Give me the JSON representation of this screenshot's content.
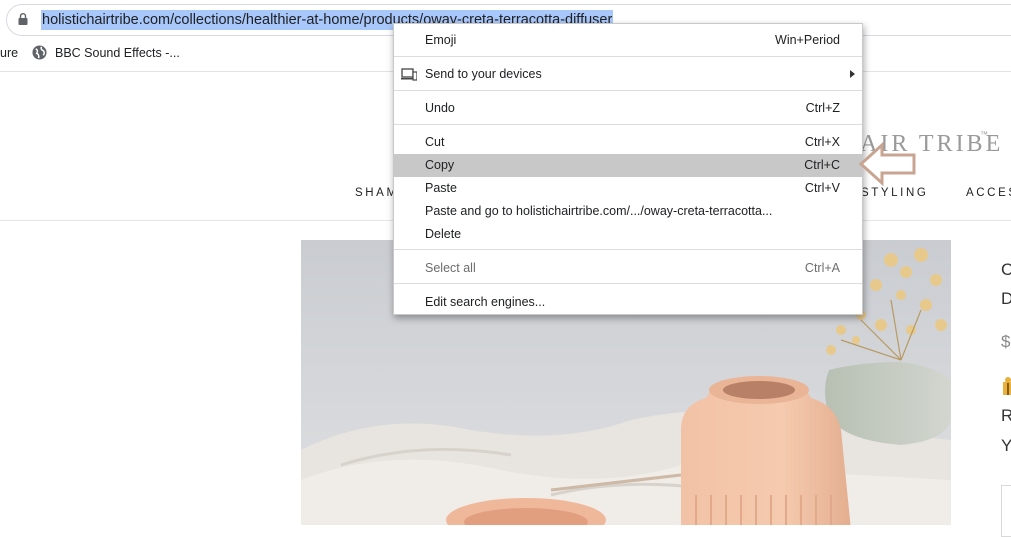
{
  "browser": {
    "url": "holistichairtribe.com/collections/healthier-at-home/products/oway-creta-terracotta-diffuser",
    "bookmarks": [
      {
        "label": "ure"
      },
      {
        "label": "BBC Sound Effects -..."
      }
    ]
  },
  "site": {
    "brand": "AIR TRIBE",
    "trademark": "™",
    "nav": [
      "SHAM",
      "STYLING",
      "ACCES"
    ],
    "side_text": [
      "C",
      "D",
      "$",
      "R",
      "Y"
    ]
  },
  "context_menu": {
    "items": [
      {
        "label": "Emoji",
        "shortcut": "Win+Period"
      },
      {
        "label": "Send to your devices",
        "shortcut": ""
      },
      {
        "label": "Undo",
        "shortcut": "Ctrl+Z"
      },
      {
        "label": "Cut",
        "shortcut": "Ctrl+X"
      },
      {
        "label": "Copy",
        "shortcut": "Ctrl+C"
      },
      {
        "label": "Paste",
        "shortcut": "Ctrl+V"
      },
      {
        "label": "Paste and go to holistichairtribe.com/.../oway-creta-terracotta...",
        "shortcut": ""
      },
      {
        "label": "Delete",
        "shortcut": ""
      },
      {
        "label": "Select all",
        "shortcut": "Ctrl+A"
      },
      {
        "label": "Edit search engines...",
        "shortcut": ""
      }
    ],
    "highlighted": "Copy"
  },
  "colors": {
    "url_selection": "#a8c7fa",
    "menu_highlight": "#c8c8c8",
    "annotation_arrow": "#c8a592"
  }
}
